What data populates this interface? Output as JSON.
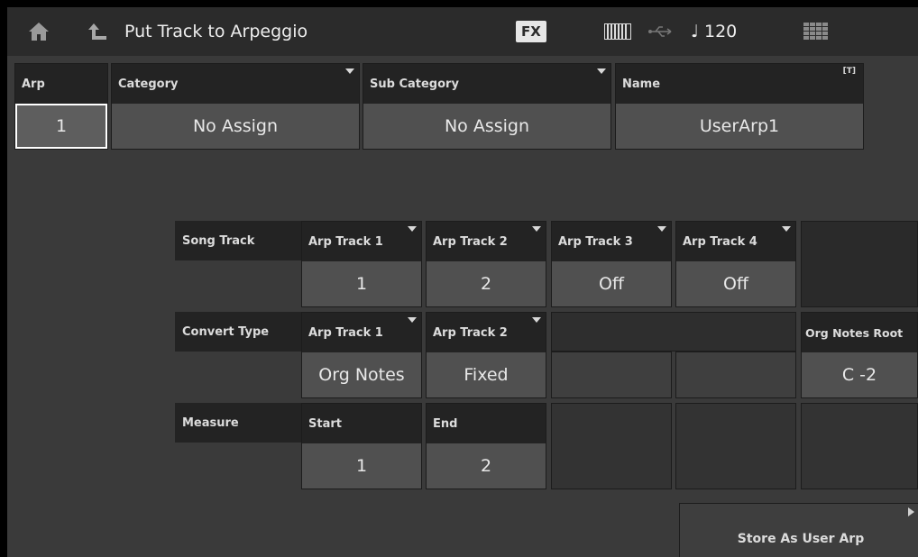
{
  "header": {
    "title": "Put Track to Arpeggio",
    "fx": "FX",
    "tempo": "♩ 120"
  },
  "arp": {
    "label": "Arp",
    "value": "1"
  },
  "category": {
    "label": "Category",
    "value": "No Assign"
  },
  "sub_category": {
    "label": "Sub Category",
    "value": "No Assign"
  },
  "name": {
    "label": "Name",
    "value": "UserArp1",
    "edit_marker": "[T]"
  },
  "song_track": {
    "row_label": "Song Track",
    "tracks": [
      {
        "label": "Arp Track 1",
        "value": "1"
      },
      {
        "label": "Arp Track 2",
        "value": "2"
      },
      {
        "label": "Arp Track 3",
        "value": "Off"
      },
      {
        "label": "Arp Track 4",
        "value": "Off"
      }
    ]
  },
  "convert_type": {
    "row_label": "Convert Type",
    "tracks": [
      {
        "label": "Arp Track 1",
        "value": "Org Notes"
      },
      {
        "label": "Arp Track 2",
        "value": "Fixed"
      }
    ],
    "org_notes_root": {
      "label": "Org Notes Root",
      "value": "C -2"
    }
  },
  "measure": {
    "row_label": "Measure",
    "start": {
      "label": "Start",
      "value": "1"
    },
    "end": {
      "label": "End",
      "value": "2"
    }
  },
  "store_button": {
    "label": "Store As User Arp"
  },
  "icons": [
    "home-icon",
    "back-icon",
    "keyboard-icon",
    "usb-icon",
    "grid-icon"
  ],
  "colors": {
    "background": "#3a3a3a",
    "label_bg": "#232323",
    "value_bg": "#505050",
    "titlebar": "#2b2b2b"
  }
}
